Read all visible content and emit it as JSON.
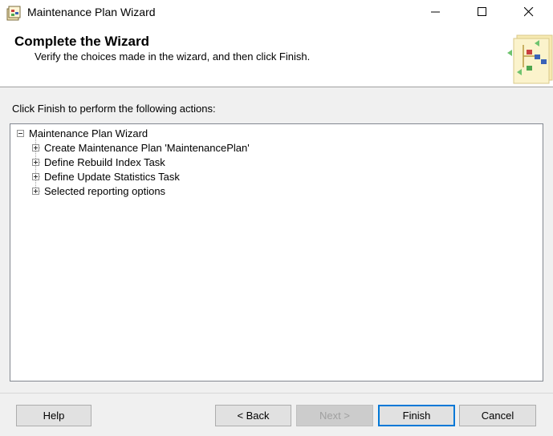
{
  "window": {
    "title": "Maintenance Plan Wizard",
    "icon": "wizard-app-icon"
  },
  "header": {
    "title": "Complete the Wizard",
    "subtitle": "Verify the choices made in the wizard, and then click Finish."
  },
  "body": {
    "instruction": "Click Finish to perform the following actions:"
  },
  "tree": {
    "root": {
      "label": "Maintenance Plan Wizard",
      "expanded": true
    },
    "children": [
      {
        "label": "Create Maintenance Plan 'MaintenancePlan'",
        "expanded": false
      },
      {
        "label": "Define Rebuild Index Task",
        "expanded": false
      },
      {
        "label": "Define Update Statistics Task",
        "expanded": false
      },
      {
        "label": "Selected reporting options",
        "expanded": false
      }
    ]
  },
  "buttons": {
    "help": "Help",
    "back": "< Back",
    "next": "Next >",
    "finish": "Finish",
    "cancel": "Cancel"
  },
  "colors": {
    "accent": "#0078d7",
    "dialog_bg": "#f0f0f0",
    "button_bg": "#e1e1e1"
  }
}
